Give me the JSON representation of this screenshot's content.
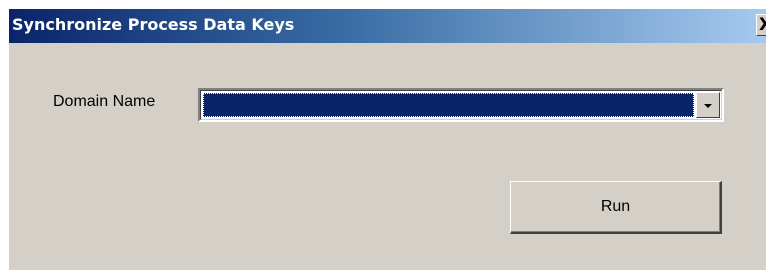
{
  "window": {
    "title": "Synchronize Process Data Keys",
    "close_label": "X"
  },
  "form": {
    "domain_label": "Domain Name",
    "domain_value": "",
    "run_label": "Run"
  },
  "colors": {
    "titlebar_start": "#0a246a",
    "titlebar_end": "#a6caf0",
    "face": "#d4d0c8",
    "selection": "#0a246a"
  },
  "icons": {
    "close": "close-icon",
    "dropdown": "chevron-down-icon"
  }
}
